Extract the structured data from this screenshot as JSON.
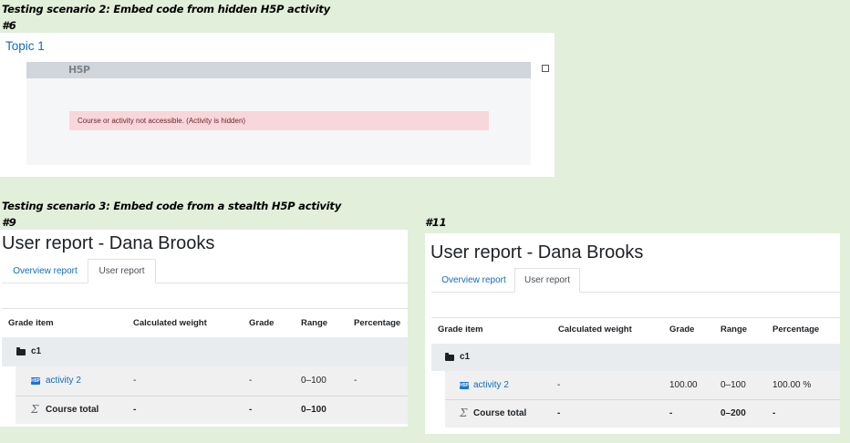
{
  "scenario2": {
    "heading": "Testing scenario 2: Embed code from hidden H5P activity",
    "case_label": "#6",
    "topic_link": "Topic 1",
    "h5p_logo": "H5P",
    "alert_message": "Course or activity not accessible. (Activity is hidden)"
  },
  "scenario3": {
    "heading": "Testing scenario 3: Embed code from a stealth H5P activity"
  },
  "report9": {
    "case_label": "#9",
    "title": "User report - Dana Brooks",
    "tabs": [
      "Overview report",
      "User report"
    ],
    "headers": [
      "Grade item",
      "Calculated weight",
      "Grade",
      "Range",
      "Percentage"
    ],
    "category": "c1",
    "rows": [
      {
        "item": "activity 2",
        "weight": "-",
        "grade": "-",
        "range": "0–100",
        "percentage": "-"
      },
      {
        "item": "Course total",
        "weight": "-",
        "grade": "-",
        "range": "0–100",
        "percentage": ""
      }
    ]
  },
  "report11": {
    "case_label": "#11",
    "title": "User report - Dana Brooks",
    "tabs": [
      "Overview report",
      "User report"
    ],
    "headers": [
      "Grade item",
      "Calculated weight",
      "Grade",
      "Range",
      "Percentage"
    ],
    "category": "c1",
    "rows": [
      {
        "item": "activity 2",
        "weight": "-",
        "grade": "100.00",
        "range": "0–100",
        "percentage": "100.00 %"
      },
      {
        "item": "Course total",
        "weight": "-",
        "grade": "-",
        "range": "0–200",
        "percentage": "-"
      }
    ]
  },
  "icons": {
    "category": "folder-icon",
    "activity": "h5p-icon",
    "total": "sigma-icon"
  },
  "colors": {
    "background": "#e2efda",
    "link": "#0f6cbf",
    "alert_bg": "#f8d7da",
    "row_band": "#f0f0f0"
  }
}
